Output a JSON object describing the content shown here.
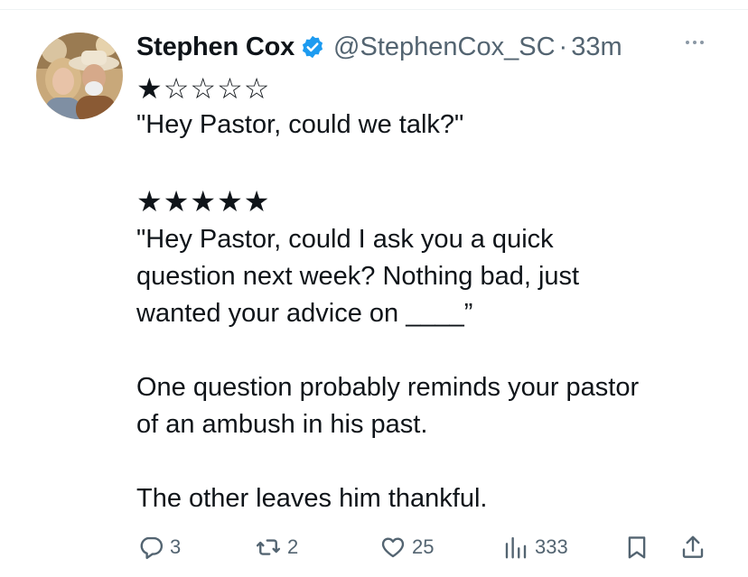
{
  "tweet": {
    "author": {
      "display_name": "Stephen Cox",
      "handle": "@StephenCox_SC",
      "verified": true
    },
    "separator": "·",
    "timestamp": "33m",
    "rating_one": "★☆☆☆☆",
    "quote_one": "\"Hey Pastor, could we talk?\"",
    "rating_five": "★★★★★",
    "quote_five_lines": [
      "\"Hey Pastor, could I ask you a quick",
      "question next week? Nothing bad, just",
      "wanted your advice on ____”"
    ],
    "paragraph_one_lines": [
      "One question probably reminds your pastor",
      "of an ambush in his past."
    ],
    "paragraph_two": "The other leaves him thankful."
  },
  "actions": {
    "replies": "3",
    "reposts": "2",
    "likes": "25",
    "views": "333"
  },
  "icons": {
    "verified": "verified-badge-icon",
    "more": "more-icon",
    "reply": "reply-icon",
    "repost": "repost-icon",
    "like": "heart-icon",
    "views": "views-icon",
    "bookmark": "bookmark-icon",
    "share": "share-icon"
  },
  "colors": {
    "text": "#0f1419",
    "secondary": "#536471",
    "verified": "#1d9bf0"
  }
}
